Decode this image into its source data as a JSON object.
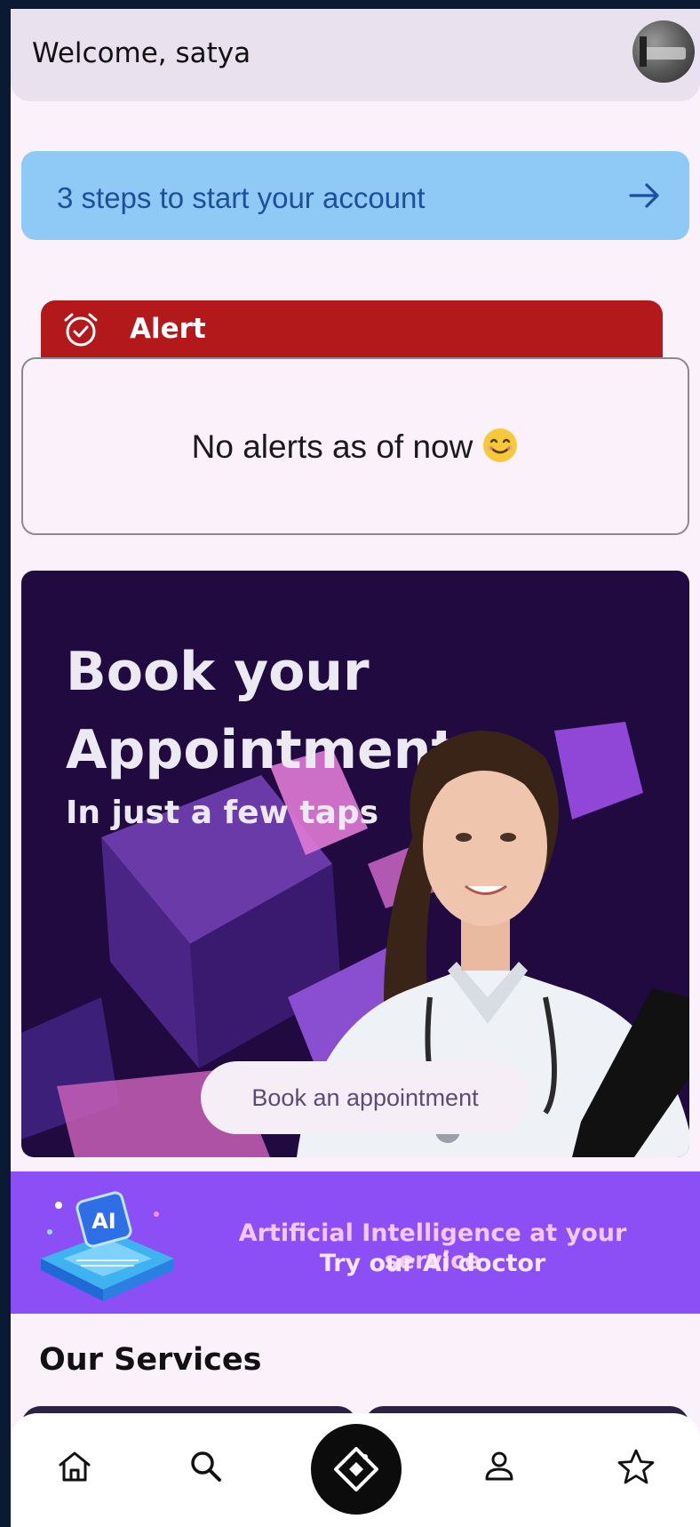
{
  "header": {
    "welcome_text": "Welcome, satya",
    "avatar_icon": "user-avatar"
  },
  "onboarding": {
    "label": "3 steps to start your account",
    "icon": "arrow-right-icon",
    "background": "#8fc9f5",
    "text_color": "#1d4f9c"
  },
  "alert": {
    "title": "Alert",
    "icon": "alarm-check-icon",
    "message": "No alerts as of now",
    "emoji": "smiling-face",
    "color": "#b3191a"
  },
  "promo": {
    "title": "Book your Appointment",
    "subtitle": "In just a few taps",
    "button_label": "Book an appointment",
    "background": "#200a3f"
  },
  "ai_banner": {
    "line1": "Artificial Intelligence at your service",
    "line2": "Try our Ai doctor",
    "chip_label": "AI",
    "background": "#8c4ff6"
  },
  "services": {
    "title": "Our Services"
  },
  "bottom_nav": {
    "items": [
      {
        "name": "home",
        "icon": "home-icon"
      },
      {
        "name": "search",
        "icon": "search-icon"
      },
      {
        "name": "center",
        "icon": "diamond-tag-icon"
      },
      {
        "name": "profile",
        "icon": "person-icon"
      },
      {
        "name": "favorites",
        "icon": "star-icon"
      }
    ]
  }
}
